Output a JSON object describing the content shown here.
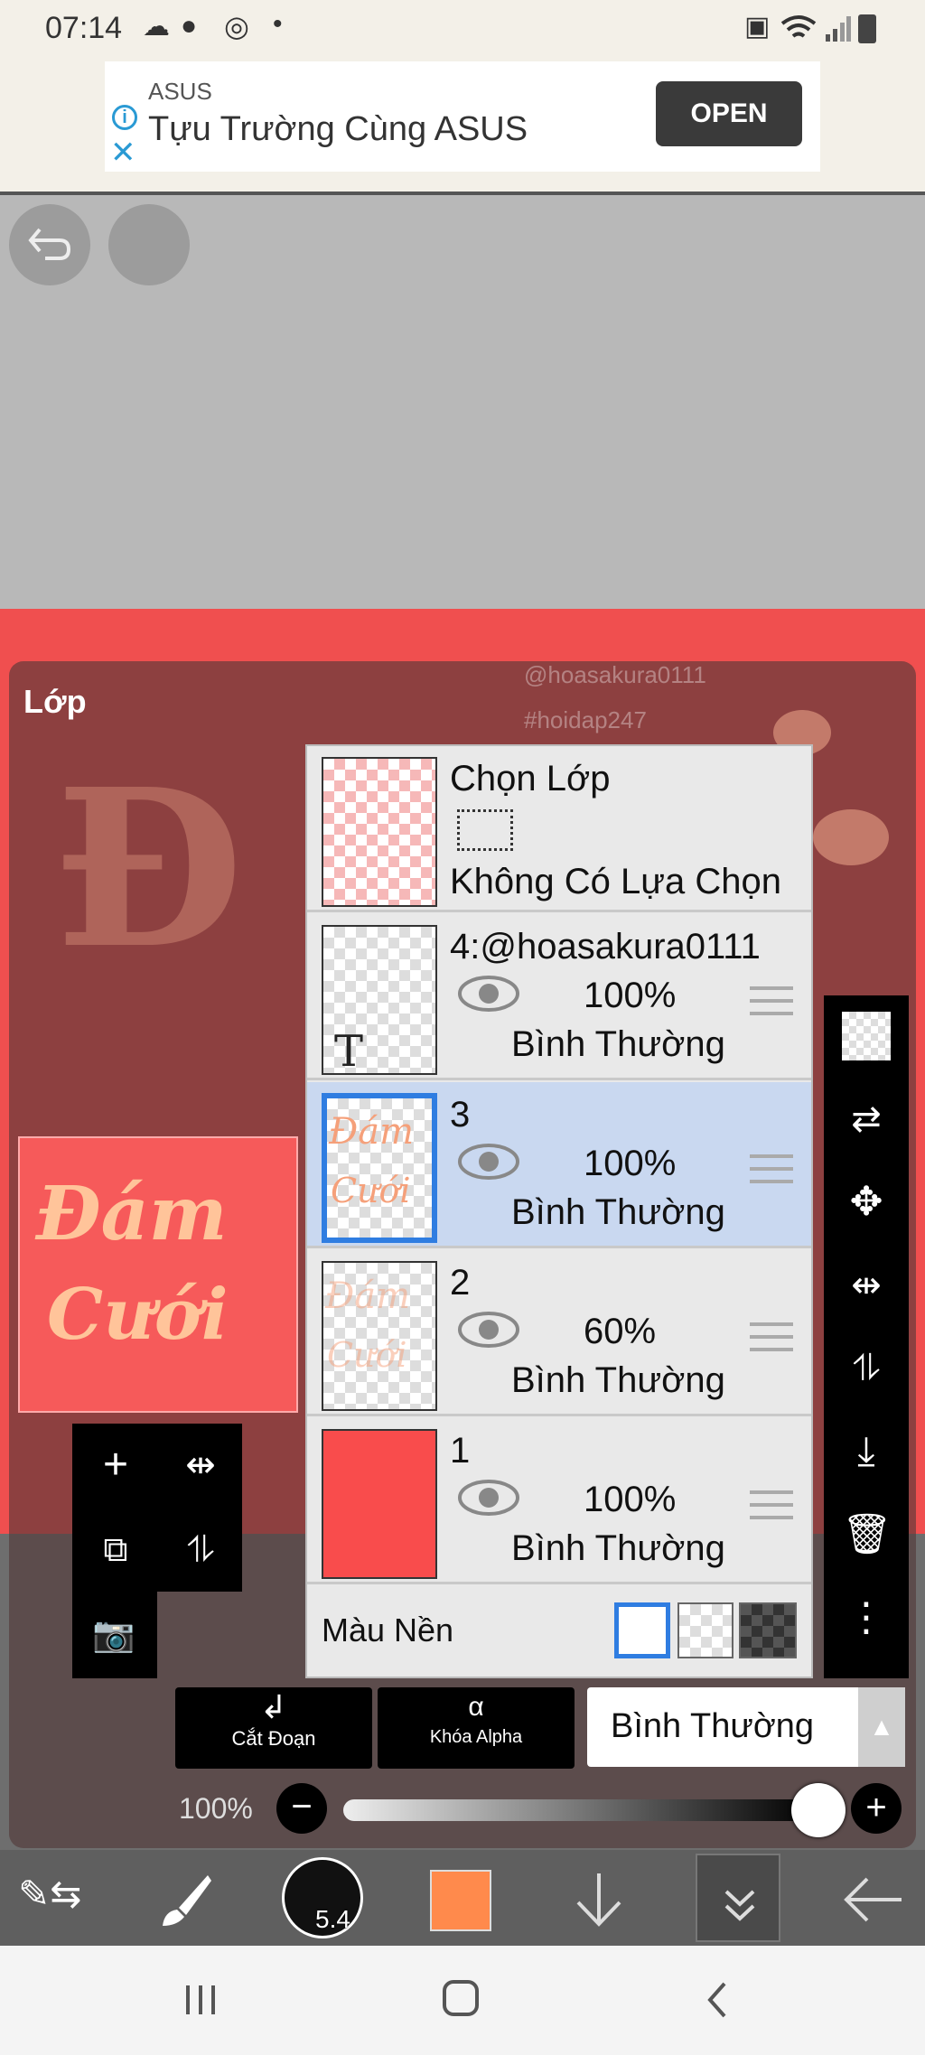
{
  "status": {
    "time": "07:14"
  },
  "ad": {
    "brand": "ASUS",
    "title": "Tựu Trường Cùng ASUS",
    "open_label": "OPEN"
  },
  "panel": {
    "title": "Lớp"
  },
  "watermark": {
    "line1": "@hoasakura0111",
    "line2": "#hoidap247"
  },
  "selection_layer": {
    "title": "Chọn Lớp",
    "status": "Không Có Lựa Chọn"
  },
  "layers": [
    {
      "name": "4:@hoasakura0111",
      "opacity": "100%",
      "mode": "Bình Thường",
      "thumb_type": "text",
      "thumb_glyph": "T"
    },
    {
      "name": "3",
      "opacity": "100%",
      "mode": "Bình Thường",
      "thumb_type": "art",
      "selected": true
    },
    {
      "name": "2",
      "opacity": "60%",
      "mode": "Bình Thường",
      "thumb_type": "art-faded"
    },
    {
      "name": "1",
      "opacity": "100%",
      "mode": "Bình Thường",
      "thumb_type": "fill",
      "fill_color": "#f94c4c"
    }
  ],
  "background": {
    "label": "Màu Nền"
  },
  "actions": {
    "clip_label": "Cắt Đoạn",
    "alpha_lock_label": "Khóa Alpha",
    "blend_mode": "Bình Thường"
  },
  "opacity_slider": {
    "label": "100%",
    "value": 1.0
  },
  "brush": {
    "size": "5.4"
  },
  "colors": {
    "accent": "#2f7de1",
    "canvas_red": "#f04f4f",
    "current_color": "#ff8a4c"
  }
}
